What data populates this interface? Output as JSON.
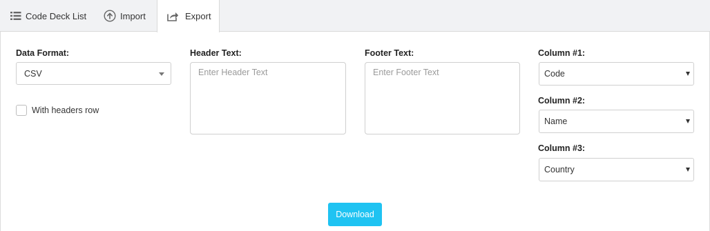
{
  "tabs": {
    "code_deck_list": {
      "label": "Code Deck List",
      "icon": "list-icon"
    },
    "import": {
      "label": "Import",
      "icon": "upload-circle-icon"
    },
    "export": {
      "label": "Export",
      "icon": "share-export-icon",
      "active": true
    }
  },
  "form": {
    "data_format": {
      "label": "Data Format:",
      "value": "CSV"
    },
    "with_headers": {
      "label": "With headers row",
      "checked": false
    },
    "header_text": {
      "label": "Header Text:",
      "placeholder": "Enter Header Text",
      "value": ""
    },
    "footer_text": {
      "label": "Footer Text:",
      "placeholder": "Enter Footer Text",
      "value": ""
    },
    "column1": {
      "label": "Column #1:",
      "value": "Code"
    },
    "column2": {
      "label": "Column #2:",
      "value": "Name"
    },
    "column3": {
      "label": "Column #3:",
      "value": "Country"
    }
  },
  "download_button": {
    "label": "Download"
  },
  "colors": {
    "accent": "#1fc3f2",
    "tabbar_bg": "#f1f2f4",
    "border": "#cfcfcf"
  }
}
